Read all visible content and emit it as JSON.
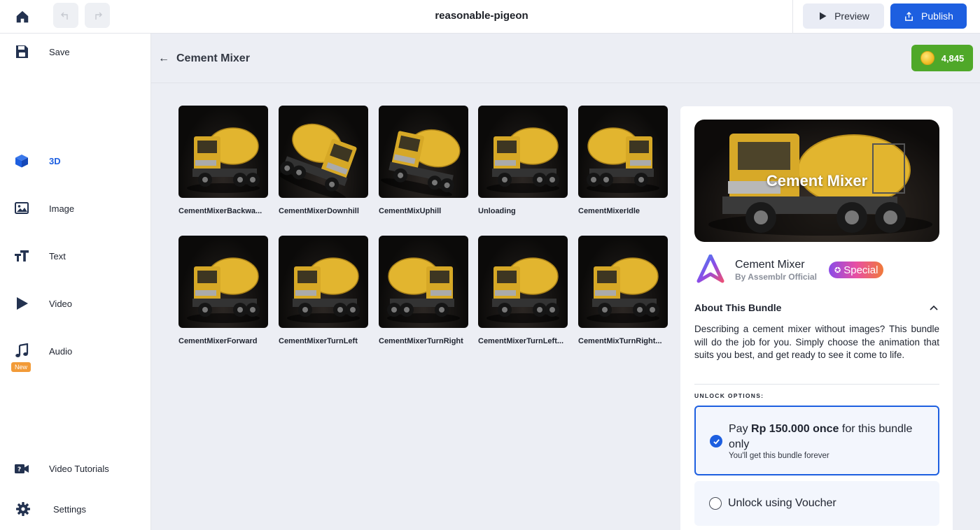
{
  "app": {
    "title": "reasonable-pigeon"
  },
  "toolbar": {
    "preview_label": "Preview",
    "publish_label": "Publish"
  },
  "sidebar": {
    "save_label": "Save",
    "items": [
      {
        "label": "3D",
        "icon": "cube-icon",
        "active": true
      },
      {
        "label": "Image",
        "icon": "image-icon"
      },
      {
        "label": "Text",
        "icon": "text-icon"
      },
      {
        "label": "Video",
        "icon": "play-icon"
      },
      {
        "label": "Audio",
        "icon": "music-note-icon",
        "badge": "New"
      }
    ],
    "tutorials_label": "Video Tutorials",
    "settings_label": "Settings"
  },
  "page": {
    "title": "Cement Mixer",
    "coins": "4,845"
  },
  "animations": [
    {
      "label": "CementMixerBackwa..."
    },
    {
      "label": "CementMixerDownhill"
    },
    {
      "label": "CementMixUphill"
    },
    {
      "label": "Unloading"
    },
    {
      "label": "CementMixerIdle"
    },
    {
      "label": "CementMixerForward"
    },
    {
      "label": "CementMixerTurnLeft"
    },
    {
      "label": "CementMixerTurnRight"
    },
    {
      "label": "CementMixerTurnLeft..."
    },
    {
      "label": "CementMixTurnRight..."
    }
  ],
  "bundle": {
    "hero_title": "Cement Mixer",
    "name": "Cement Mixer",
    "author": "By Assemblr Official",
    "badge": "Special",
    "about_heading": "About This Bundle",
    "description": "Describing a cement mixer without images? This bundle will do the job for you. Simply choose the animation that suits you best, and get ready to see it come to life.",
    "unlock_heading": "UNLOCK OPTIONS:",
    "option_pay": {
      "prefix": "Pay ",
      "price": "Rp 150.000 once",
      "suffix": " for this bundle only",
      "note": "You'll get this bundle forever",
      "selected": true
    },
    "option_voucher": {
      "label": "Unlock using Voucher",
      "selected": false
    }
  },
  "colors": {
    "accent": "#1d5fe0",
    "coin_badge": "#4fa829",
    "truck_yellow": "#e2b52f"
  }
}
